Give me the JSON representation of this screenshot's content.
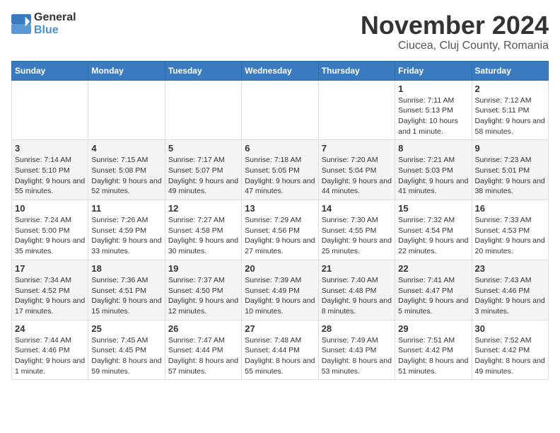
{
  "logo": {
    "text_general": "General",
    "text_blue": "Blue"
  },
  "header": {
    "month_year": "November 2024",
    "location": "Ciucea, Cluj County, Romania"
  },
  "weekdays": [
    "Sunday",
    "Monday",
    "Tuesday",
    "Wednesday",
    "Thursday",
    "Friday",
    "Saturday"
  ],
  "weeks": [
    [
      {
        "day": "",
        "info": ""
      },
      {
        "day": "",
        "info": ""
      },
      {
        "day": "",
        "info": ""
      },
      {
        "day": "",
        "info": ""
      },
      {
        "day": "",
        "info": ""
      },
      {
        "day": "1",
        "info": "Sunrise: 7:11 AM\nSunset: 5:13 PM\nDaylight: 10 hours and 1 minute."
      },
      {
        "day": "2",
        "info": "Sunrise: 7:12 AM\nSunset: 5:11 PM\nDaylight: 9 hours and 58 minutes."
      }
    ],
    [
      {
        "day": "3",
        "info": "Sunrise: 7:14 AM\nSunset: 5:10 PM\nDaylight: 9 hours and 55 minutes."
      },
      {
        "day": "4",
        "info": "Sunrise: 7:15 AM\nSunset: 5:08 PM\nDaylight: 9 hours and 52 minutes."
      },
      {
        "day": "5",
        "info": "Sunrise: 7:17 AM\nSunset: 5:07 PM\nDaylight: 9 hours and 49 minutes."
      },
      {
        "day": "6",
        "info": "Sunrise: 7:18 AM\nSunset: 5:05 PM\nDaylight: 9 hours and 47 minutes."
      },
      {
        "day": "7",
        "info": "Sunrise: 7:20 AM\nSunset: 5:04 PM\nDaylight: 9 hours and 44 minutes."
      },
      {
        "day": "8",
        "info": "Sunrise: 7:21 AM\nSunset: 5:03 PM\nDaylight: 9 hours and 41 minutes."
      },
      {
        "day": "9",
        "info": "Sunrise: 7:23 AM\nSunset: 5:01 PM\nDaylight: 9 hours and 38 minutes."
      }
    ],
    [
      {
        "day": "10",
        "info": "Sunrise: 7:24 AM\nSunset: 5:00 PM\nDaylight: 9 hours and 35 minutes."
      },
      {
        "day": "11",
        "info": "Sunrise: 7:26 AM\nSunset: 4:59 PM\nDaylight: 9 hours and 33 minutes."
      },
      {
        "day": "12",
        "info": "Sunrise: 7:27 AM\nSunset: 4:58 PM\nDaylight: 9 hours and 30 minutes."
      },
      {
        "day": "13",
        "info": "Sunrise: 7:29 AM\nSunset: 4:56 PM\nDaylight: 9 hours and 27 minutes."
      },
      {
        "day": "14",
        "info": "Sunrise: 7:30 AM\nSunset: 4:55 PM\nDaylight: 9 hours and 25 minutes."
      },
      {
        "day": "15",
        "info": "Sunrise: 7:32 AM\nSunset: 4:54 PM\nDaylight: 9 hours and 22 minutes."
      },
      {
        "day": "16",
        "info": "Sunrise: 7:33 AM\nSunset: 4:53 PM\nDaylight: 9 hours and 20 minutes."
      }
    ],
    [
      {
        "day": "17",
        "info": "Sunrise: 7:34 AM\nSunset: 4:52 PM\nDaylight: 9 hours and 17 minutes."
      },
      {
        "day": "18",
        "info": "Sunrise: 7:36 AM\nSunset: 4:51 PM\nDaylight: 9 hours and 15 minutes."
      },
      {
        "day": "19",
        "info": "Sunrise: 7:37 AM\nSunset: 4:50 PM\nDaylight: 9 hours and 12 minutes."
      },
      {
        "day": "20",
        "info": "Sunrise: 7:39 AM\nSunset: 4:49 PM\nDaylight: 9 hours and 10 minutes."
      },
      {
        "day": "21",
        "info": "Sunrise: 7:40 AM\nSunset: 4:48 PM\nDaylight: 9 hours and 8 minutes."
      },
      {
        "day": "22",
        "info": "Sunrise: 7:41 AM\nSunset: 4:47 PM\nDaylight: 9 hours and 5 minutes."
      },
      {
        "day": "23",
        "info": "Sunrise: 7:43 AM\nSunset: 4:46 PM\nDaylight: 9 hours and 3 minutes."
      }
    ],
    [
      {
        "day": "24",
        "info": "Sunrise: 7:44 AM\nSunset: 4:46 PM\nDaylight: 9 hours and 1 minute."
      },
      {
        "day": "25",
        "info": "Sunrise: 7:45 AM\nSunset: 4:45 PM\nDaylight: 8 hours and 59 minutes."
      },
      {
        "day": "26",
        "info": "Sunrise: 7:47 AM\nSunset: 4:44 PM\nDaylight: 8 hours and 57 minutes."
      },
      {
        "day": "27",
        "info": "Sunrise: 7:48 AM\nSunset: 4:44 PM\nDaylight: 8 hours and 55 minutes."
      },
      {
        "day": "28",
        "info": "Sunrise: 7:49 AM\nSunset: 4:43 PM\nDaylight: 8 hours and 53 minutes."
      },
      {
        "day": "29",
        "info": "Sunrise: 7:51 AM\nSunset: 4:42 PM\nDaylight: 8 hours and 51 minutes."
      },
      {
        "day": "30",
        "info": "Sunrise: 7:52 AM\nSunset: 4:42 PM\nDaylight: 8 hours and 49 minutes."
      }
    ]
  ]
}
